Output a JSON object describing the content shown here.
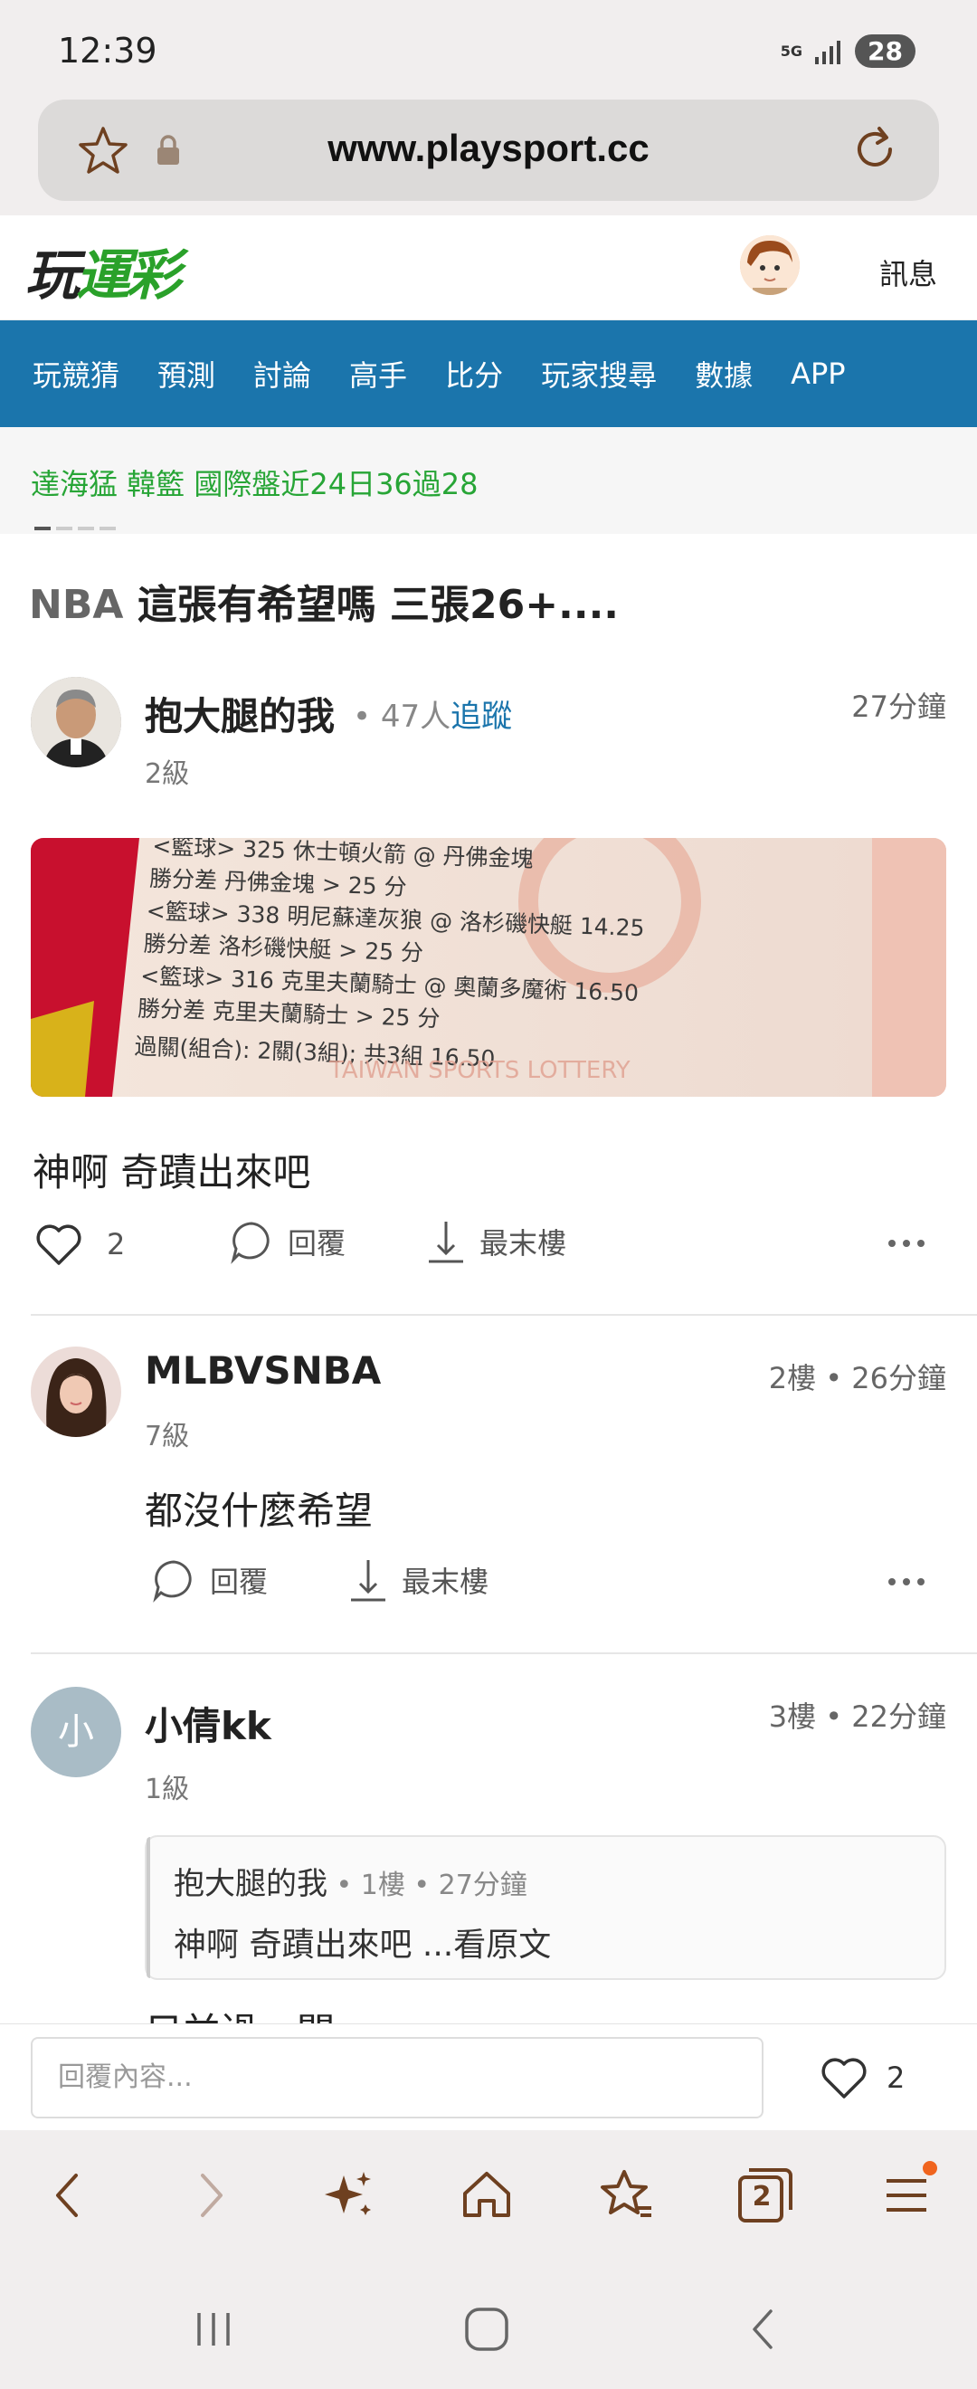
{
  "status_bar": {
    "time": "12:39",
    "network": "5G",
    "battery": "28"
  },
  "browser": {
    "url": "www.playsport.cc",
    "tab_count": "2"
  },
  "site": {
    "logo_part1": "玩",
    "logo_part2": "運彩",
    "messages_label": "訊息",
    "nav": [
      "玩競猜",
      "預測",
      "討論",
      "高手",
      "比分",
      "玩家搜尋",
      "數據",
      "APP"
    ],
    "ticker": "達海猛  韓籃 國際盤近24日36過28"
  },
  "post": {
    "tag": "NBA",
    "title": " 這張有希望嗎 三張26+....",
    "author": "抱大腿的我",
    "followers_prefix": " • 47人",
    "follow_label": "追蹤",
    "level": "2級",
    "time": "27分鐘",
    "body": "神啊 奇蹟出來吧",
    "likes": "2",
    "reply_label": "回覆",
    "last_floor_label": "最末樓",
    "ticket_lines": [
      "<籃球> 325   休士頓火箭 @ 丹佛金塊",
      "勝分差        丹佛金塊 > 25 分",
      "<籃球> 338   明尼蘇達灰狼 @ 洛杉磯快艇     14.25",
      "勝分差        洛杉磯快艇 > 25 分",
      "<籃球> 316   克里夫蘭騎士 @ 奧蘭多魔術     16.50",
      "勝分差        克里夫蘭騎士 > 25 分",
      "過關(組合): 2關(3組); 共3組            16.50"
    ],
    "ticket_watermark": "TAIWAN SPORTS LOTTERY"
  },
  "comments": [
    {
      "avatar_letter": "",
      "name": "MLBVSNBA",
      "level": "7級",
      "time": "2樓 • 26分鐘",
      "body": "都沒什麼希望",
      "reply_label": "回覆",
      "last_floor_label": "最末樓"
    },
    {
      "avatar_letter": "小",
      "name": "小倩kk",
      "level": "1級",
      "time": "3樓 • 22分鐘",
      "quote_author": "抱大腿的我",
      "quote_meta": " • 1樓 • 27分鐘",
      "quote_body": "神啊 奇蹟出來吧 ...看原文",
      "body_partial": "只並過一關"
    }
  ],
  "reply_bar": {
    "placeholder": "回覆內容...",
    "likes": "2"
  },
  "colors": {
    "nav_bg": "#1b75ac",
    "ticker_green": "#27a536",
    "toolbar_icon": "#6e4020",
    "accent_orange": "#f0641e"
  }
}
